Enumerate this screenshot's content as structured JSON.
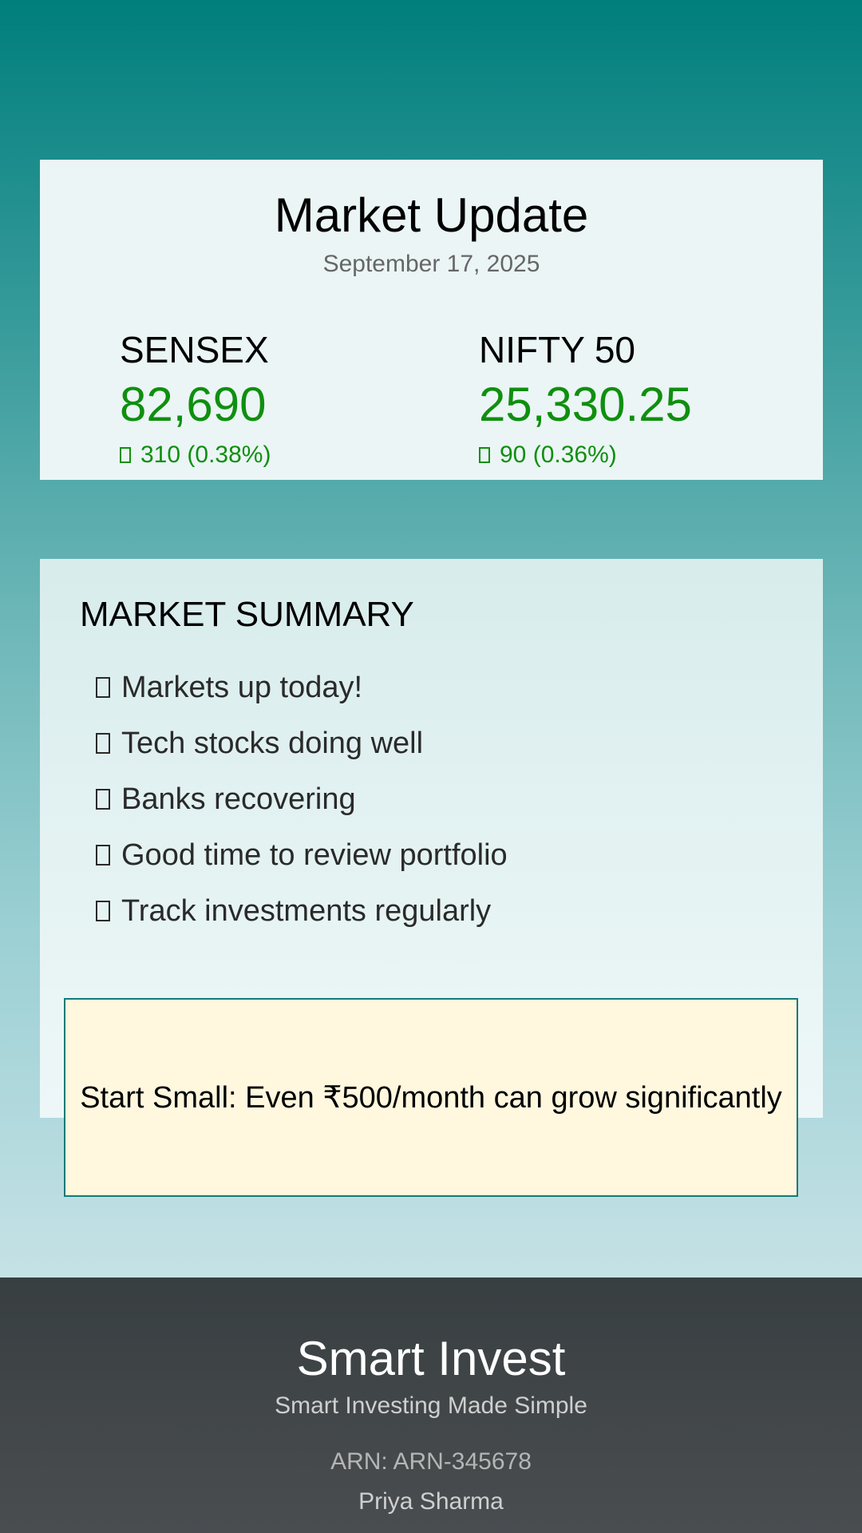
{
  "market": {
    "title": "Market Update",
    "date": "September 17, 2025",
    "indices": [
      {
        "name": "SENSEX",
        "value": "82,690",
        "change": "310 (0.38%)",
        "direction_icon": "up-arrow-icon"
      },
      {
        "name": "NIFTY 50",
        "value": "25,330.25",
        "change": "90 (0.36%)",
        "direction_icon": "up-arrow-icon"
      }
    ]
  },
  "summary": {
    "heading": "MARKET SUMMARY",
    "items": [
      "Markets up today!",
      "Tech stocks doing well",
      "Banks recovering",
      "Good time to review portfolio",
      "Track investments regularly"
    ]
  },
  "tip": {
    "text": "Start Small: Even ₹500/month can grow significantly"
  },
  "footer": {
    "brand": "Smart Invest",
    "tagline": "Smart Investing Made Simple",
    "arn": "ARN: ARN-345678",
    "advisor": "Priya Sharma"
  },
  "colors": {
    "positive": "#0f8f0f",
    "accent_border": "#137a76",
    "tip_background": "#fff8de",
    "footer_background": "#3f4548"
  }
}
